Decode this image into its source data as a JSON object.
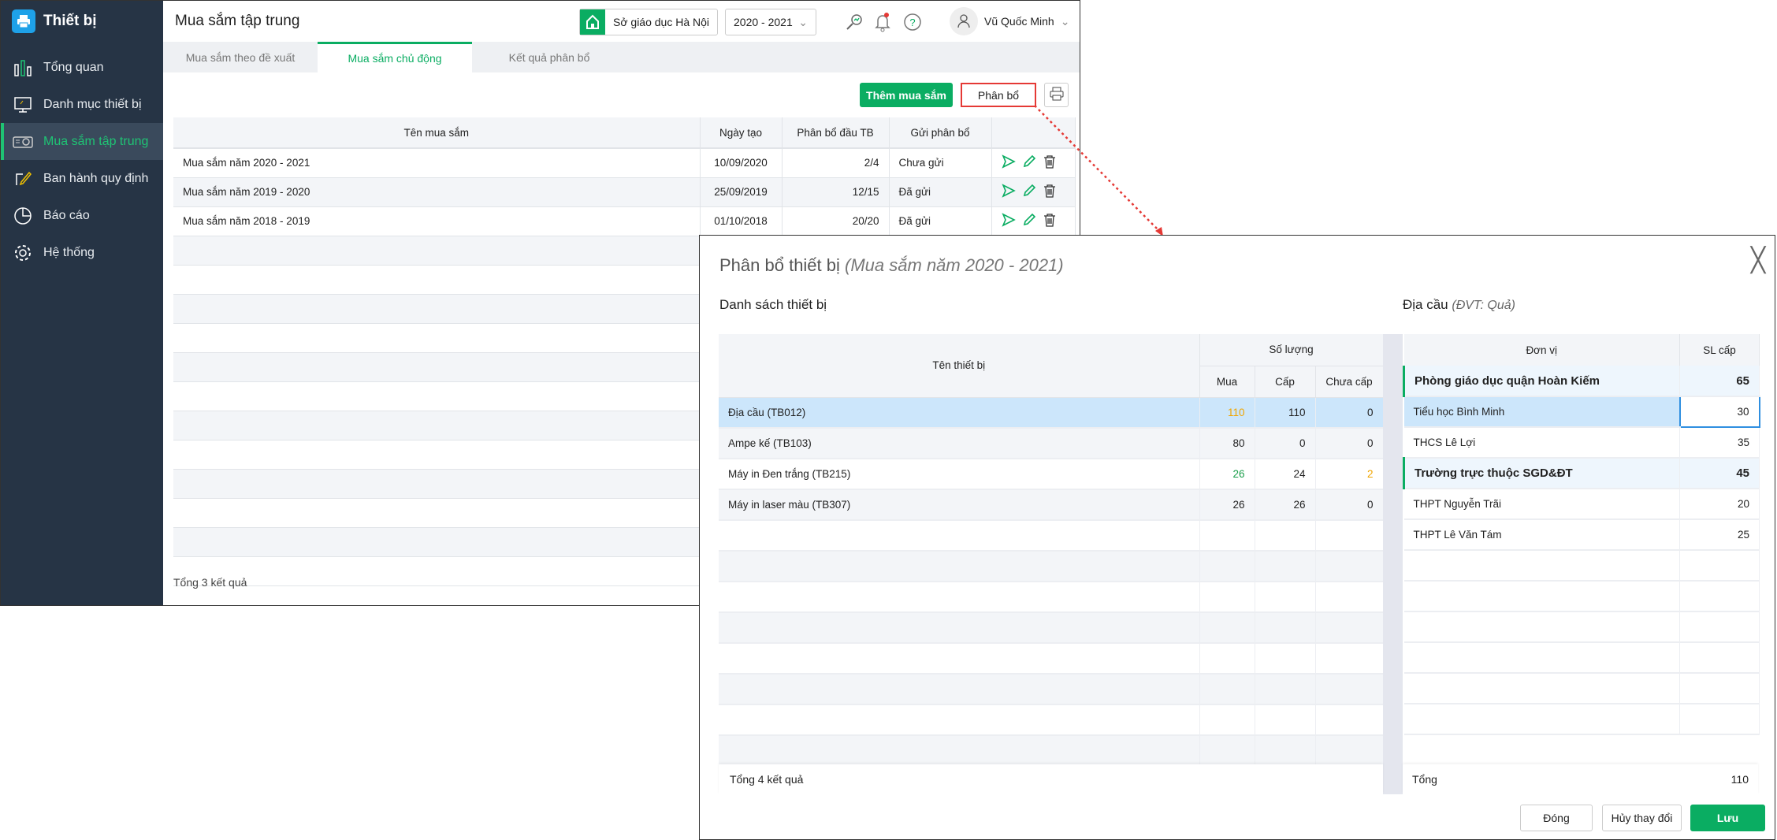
{
  "sidebar": {
    "brand": "Thiết bị",
    "items": [
      {
        "label": "Tổng quan",
        "icon": "bar-chart-icon"
      },
      {
        "label": "Danh mục thiết bị",
        "icon": "monitor-icon"
      },
      {
        "label": "Mua sắm tập trung",
        "icon": "projector-icon",
        "active": true
      },
      {
        "label": "Ban hành quy định",
        "icon": "edit-icon"
      },
      {
        "label": "Báo cáo",
        "icon": "pie-chart-icon"
      },
      {
        "label": "Hệ thống",
        "icon": "gear-icon"
      }
    ]
  },
  "header": {
    "title": "Mua sắm tập trung",
    "org": "Sở giáo dục Hà Nội",
    "year": "2020 - 2021",
    "user": "Vũ Quốc Minh"
  },
  "tabs": [
    "Mua sắm theo đề xuất",
    "Mua sắm chủ động",
    "Kết quả phân bổ"
  ],
  "toolbar": {
    "add": "Thêm mua sắm",
    "allocate": "Phân bổ"
  },
  "purchases": {
    "columns": [
      "Tên mua sắm",
      "Ngày tạo",
      "Phân bổ đầu TB",
      "Gửi phân bổ"
    ],
    "rows": [
      [
        "Mua sắm năm 2020 - 2021",
        "10/09/2020",
        "2/4",
        "Chưa gửi"
      ],
      [
        "Mua sắm năm 2019 - 2020",
        "25/09/2019",
        "12/15",
        "Đã gửi"
      ],
      [
        "Mua sắm năm 2018 - 2019",
        "01/10/2018",
        "20/20",
        "Đã gửi"
      ]
    ],
    "footer": "Tổng 3 kết quả"
  },
  "modal": {
    "title": "Phân bổ thiết bị",
    "subtitle": "(Mua sắm năm 2020 - 2021)",
    "left_title": "Danh sách thiết bị",
    "right_title": "Địa cầu",
    "right_unit": "(ĐVT: Quả)",
    "equip": {
      "col_name": "Tên thiết bị",
      "col_qty": "Số lượng",
      "col_buy": "Mua",
      "col_alloc": "Cấp",
      "col_remain": "Chưa cấp",
      "rows": [
        {
          "name": "Địa cầu (TB012)",
          "buy": "110",
          "alloc": "110",
          "remain": "0",
          "selected": true,
          "buy_color": "yellow",
          "remain_color": ""
        },
        {
          "name": "Ampe kế (TB103)",
          "buy": "80",
          "alloc": "0",
          "remain": "0",
          "buy_color": "",
          "remain_color": ""
        },
        {
          "name": "Máy in Đen trắng (TB215)",
          "buy": "26",
          "alloc": "24",
          "remain": "2",
          "buy_color": "green",
          "remain_color": "yellow"
        },
        {
          "name": "Máy in laser màu (TB307)",
          "buy": "26",
          "alloc": "26",
          "remain": "0",
          "buy_color": "",
          "remain_color": ""
        }
      ],
      "footer": "Tổng 4 kết quả"
    },
    "units": {
      "col_unit": "Đơn vị",
      "col_qty": "SL cấp",
      "rows": [
        {
          "name": "Phòng giáo dục quận Hoàn Kiếm",
          "qty": "65",
          "group": true
        },
        {
          "name": "Tiểu học Bình Minh",
          "qty": "30",
          "selected": true
        },
        {
          "name": "THCS Lê Lợi",
          "qty": "35"
        },
        {
          "name": "Trường trực thuộc SGD&ĐT",
          "qty": "45",
          "group": true
        },
        {
          "name": "THPT Nguyễn Trãi",
          "qty": "20"
        },
        {
          "name": "THPT Lê Văn Tám",
          "qty": "25"
        }
      ],
      "total_label": "Tổng",
      "total": "110"
    },
    "buttons": {
      "close": "Đóng",
      "cancel": "Hủy thay đổi",
      "save": "Lưu"
    }
  },
  "colors": {
    "accent": "#0aad62",
    "sidebar": "#263445",
    "highlight": "#cce6fb",
    "alert": "#e53935"
  }
}
